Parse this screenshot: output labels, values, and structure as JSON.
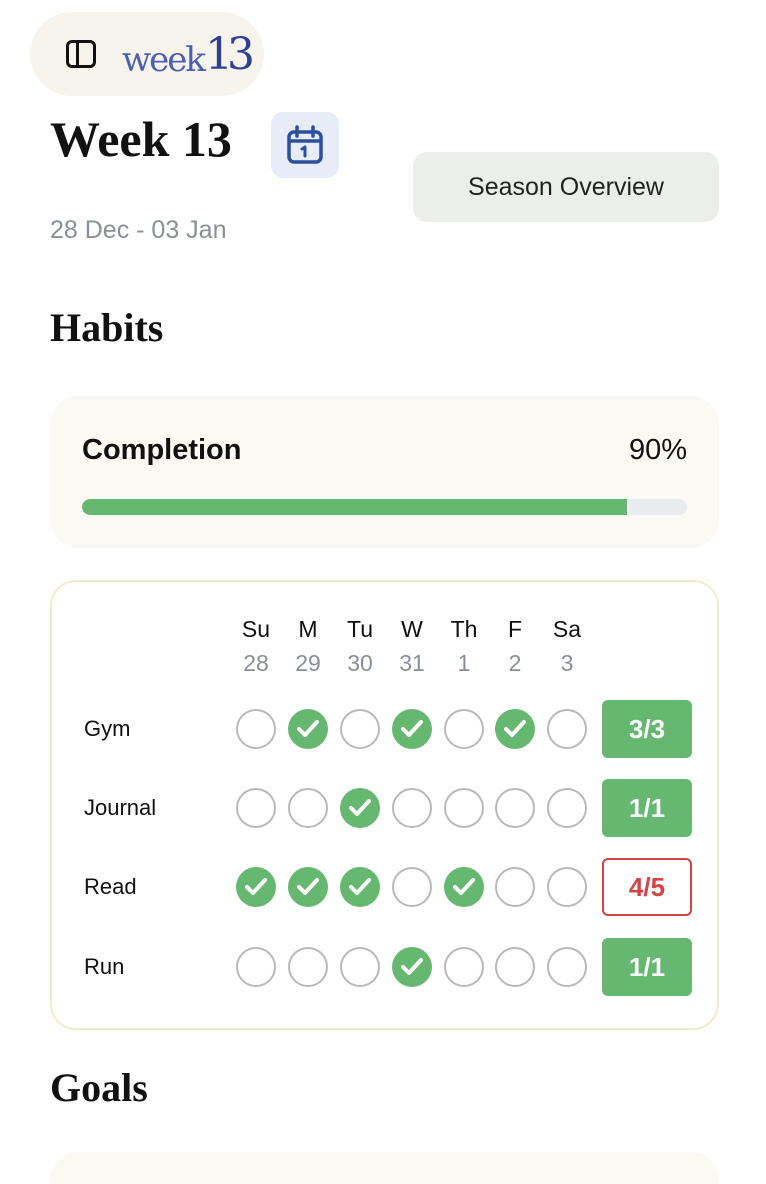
{
  "header": {
    "logo_text_a": "week",
    "logo_text_b": "13",
    "title": "Week 13",
    "date_range": "28 Dec - 03 Jan",
    "season_button": "Season Overview"
  },
  "habits_section": {
    "title": "Habits",
    "completion_label": "Completion",
    "completion_value": "90%",
    "completion_fraction": 0.9,
    "days": [
      {
        "name": "Su",
        "date": "28"
      },
      {
        "name": "M",
        "date": "29"
      },
      {
        "name": "Tu",
        "date": "30"
      },
      {
        "name": "W",
        "date": "31"
      },
      {
        "name": "Th",
        "date": "1"
      },
      {
        "name": "F",
        "date": "2"
      },
      {
        "name": "Sa",
        "date": "3"
      }
    ],
    "habits": [
      {
        "name": "Gym",
        "checks": [
          false,
          true,
          false,
          true,
          false,
          true,
          false
        ],
        "score": "3/3",
        "status": "ok"
      },
      {
        "name": "Journal",
        "checks": [
          false,
          false,
          true,
          false,
          false,
          false,
          false
        ],
        "score": "1/1",
        "status": "ok"
      },
      {
        "name": "Read",
        "checks": [
          true,
          true,
          true,
          false,
          true,
          false,
          false
        ],
        "score": "4/5",
        "status": "bad"
      },
      {
        "name": "Run",
        "checks": [
          false,
          false,
          false,
          true,
          false,
          false,
          false
        ],
        "score": "1/1",
        "status": "ok"
      }
    ]
  },
  "goals_section": {
    "title": "Goals"
  },
  "icons": {
    "sidebar": "sidebar-toggle-icon",
    "calendar": "calendar-icon",
    "check": "checkmark-icon"
  },
  "colors": {
    "accent_green": "#66b871",
    "warning_red": "#d04545",
    "calendar_blue": "#2c4fa0",
    "logo_blue": "#3f55a8"
  }
}
